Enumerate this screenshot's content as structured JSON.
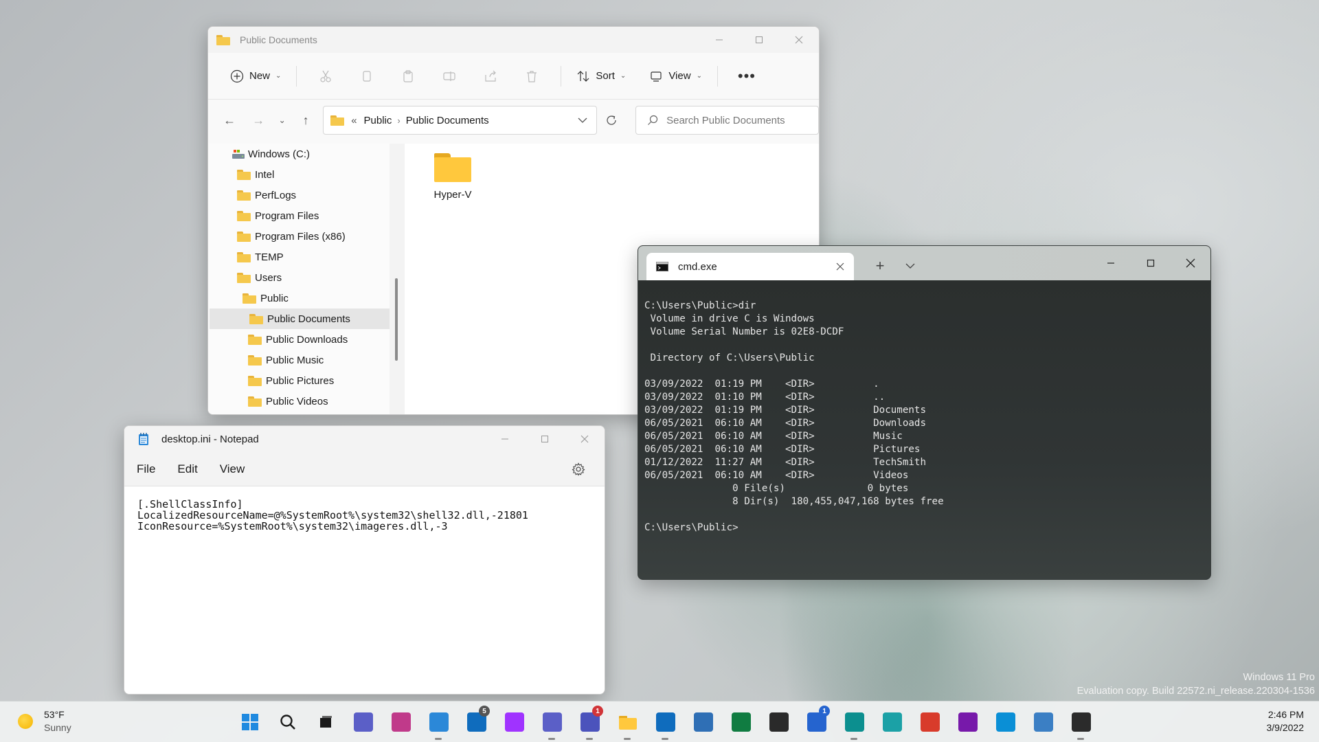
{
  "explorer": {
    "title": "Public Documents",
    "toolbar": {
      "new_label": "New",
      "sort_label": "Sort",
      "view_label": "View"
    },
    "address": {
      "overflow": "«",
      "crumbs": [
        "Public",
        "Public Documents"
      ]
    },
    "search_placeholder": "Search Public Documents",
    "tree": [
      {
        "label": "Windows (C:)",
        "level": 0,
        "icon": "drive-icon"
      },
      {
        "label": "Intel",
        "level": 1
      },
      {
        "label": "PerfLogs",
        "level": 1
      },
      {
        "label": "Program Files",
        "level": 1
      },
      {
        "label": "Program Files (x86)",
        "level": 1
      },
      {
        "label": "TEMP",
        "level": 1
      },
      {
        "label": "Users",
        "level": 1
      },
      {
        "label": "Public",
        "level": 2
      },
      {
        "label": "Public Documents",
        "level": 3,
        "selected": true
      },
      {
        "label": "Public Downloads",
        "level": 3
      },
      {
        "label": "Public Music",
        "level": 3
      },
      {
        "label": "Public Pictures",
        "level": 3
      },
      {
        "label": "Public Videos",
        "level": 3
      }
    ],
    "items": [
      {
        "name": "Hyper-V",
        "type": "folder"
      }
    ]
  },
  "notepad": {
    "title": "desktop.ini - Notepad",
    "menu": [
      "File",
      "Edit",
      "View"
    ],
    "content": "[.ShellClassInfo]\nLocalizedResourceName=@%SystemRoot%\\system32\\shell32.dll,-21801\nIconResource=%SystemRoot%\\system32\\imageres.dll,-3"
  },
  "terminal": {
    "tab_title": "cmd.exe",
    "output": "C:\\Users\\Public>dir\n Volume in drive C is Windows\n Volume Serial Number is 02E8-DCDF\n\n Directory of C:\\Users\\Public\n\n03/09/2022  01:19 PM    <DIR>          .\n03/09/2022  01:10 PM    <DIR>          ..\n03/09/2022  01:19 PM    <DIR>          Documents\n06/05/2021  06:10 AM    <DIR>          Downloads\n06/05/2021  06:10 AM    <DIR>          Music\n06/05/2021  06:10 AM    <DIR>          Pictures\n01/12/2022  11:27 AM    <DIR>          TechSmith\n06/05/2021  06:10 AM    <DIR>          Videos\n               0 File(s)              0 bytes\n               8 Dir(s)  180,455,047,168 bytes free\n\nC:\\Users\\Public>"
  },
  "watermark": {
    "line1": "Windows 11 Pro",
    "line2": "Evaluation copy. Build 22572.ni_release.220304-1536"
  },
  "taskbar": {
    "weather": {
      "temp": "53°F",
      "condition": "Sunny"
    },
    "clock": {
      "time": "2:46 PM",
      "date": "3/9/2022"
    },
    "apps": [
      {
        "name": "start-icon",
        "color": "#1f6fd6"
      },
      {
        "name": "search-icon",
        "color": "#1a1a1a"
      },
      {
        "name": "task-view-icon",
        "color": "#1a1a1a"
      },
      {
        "name": "chat-icon",
        "color": "#5b5fc7"
      },
      {
        "name": "snipping-tool-icon",
        "color": "#c03a8a"
      },
      {
        "name": "notepad-icon",
        "color": "#2b88d8",
        "running": true
      },
      {
        "name": "app-badge-icon",
        "color": "#0f6cbd",
        "badge": "5",
        "badge_color": "#555555"
      },
      {
        "name": "messenger-icon",
        "color": "#a033ff"
      },
      {
        "name": "teams-icon",
        "color": "#5b5fc7",
        "running": true
      },
      {
        "name": "teams-work-icon",
        "color": "#4b53bc",
        "badge": "1",
        "badge_color": "#d13438",
        "running": true
      },
      {
        "name": "file-explorer-icon",
        "color": "#f5c84c",
        "running": true
      },
      {
        "name": "outlook-icon",
        "color": "#0f6cbd",
        "running": true
      },
      {
        "name": "remote-desktop-icon",
        "color": "#2f6fb5"
      },
      {
        "name": "excel-icon",
        "color": "#107c41"
      },
      {
        "name": "sticky-notes-icon",
        "color": "#2a2a2a"
      },
      {
        "name": "todo-icon",
        "color": "#2564cf",
        "badge": "1",
        "badge_color": "#2564cf"
      },
      {
        "name": "edge-profile-icon",
        "color": "#0c8f8f",
        "running": true
      },
      {
        "name": "edge-icon",
        "color": "#1ba1a6"
      },
      {
        "name": "edge-canary-icon",
        "color": "#d83b2b"
      },
      {
        "name": "onenote-icon",
        "color": "#7719aa"
      },
      {
        "name": "azure-icon",
        "color": "#0a8fd6"
      },
      {
        "name": "network-icon",
        "color": "#3b7fc4"
      },
      {
        "name": "terminal-icon",
        "color": "#2b2b2b",
        "running": true
      }
    ]
  }
}
